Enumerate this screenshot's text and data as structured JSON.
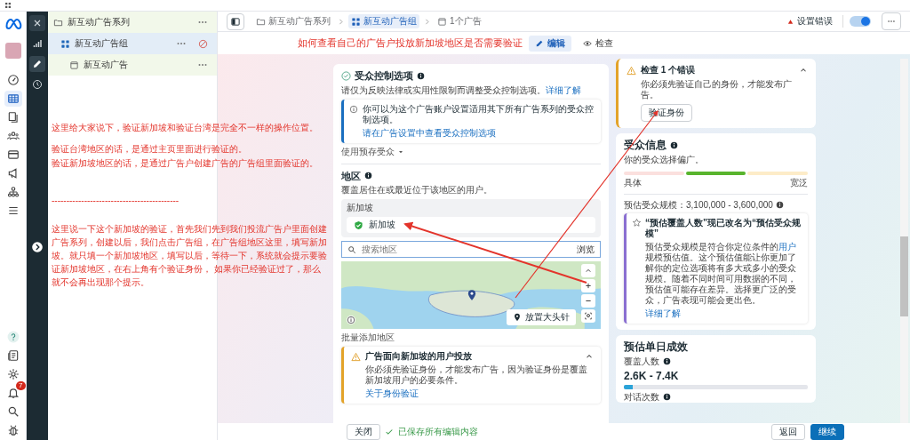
{
  "app_rail": {
    "items": [
      {
        "selected": false
      },
      {
        "selected": true
      },
      {
        "selected": false
      },
      {
        "selected": false
      },
      {
        "selected": false
      },
      {
        "selected": false
      },
      {
        "selected": false
      },
      {
        "selected": false
      }
    ],
    "notification_badge": "7"
  },
  "tool_rail": {
    "items": [
      {
        "selected": false
      },
      {
        "selected": true
      },
      {
        "selected": false
      }
    ]
  },
  "tree": [
    {
      "label": "新互动广告系列",
      "selected": false,
      "error": false,
      "children": [
        {
          "label": "新互动广告组",
          "selected": true,
          "error": true,
          "children": [
            {
              "label": "新互动广告",
              "selected": false,
              "error": false
            }
          ]
        }
      ]
    }
  ],
  "breadcrumbs": [
    {
      "label": "新互动广告系列",
      "selected": false
    },
    {
      "label": "新互动广告组",
      "selected": true
    },
    {
      "label": "1个广告",
      "selected": false
    }
  ],
  "status": {
    "label": "设置错误",
    "toggle_on": true
  },
  "mode_tabs": [
    {
      "label": "编辑",
      "selected": true
    },
    {
      "label": "检查",
      "selected": false
    }
  ],
  "audience_controls": {
    "title": "受众控制选项",
    "description": "请仅为反映法律或实用性限制而调整受众控制选项。",
    "learn_more": "详细了解",
    "info_text": "你可以为这个广告账户设置适用其下所有广告系列的受众控制选项。",
    "info_link": "请在广告设置中查看受众控制选项",
    "saved_audience": "使用预存受众"
  },
  "location": {
    "title": "地区",
    "description": "覆盖居住在或最近位于该地区的用户。",
    "group": "新加坡",
    "items": [
      {
        "label": "新加坡",
        "included": true
      }
    ],
    "search": {
      "placeholder": "搜索地区"
    },
    "browse": "浏览",
    "drop_pin": "放置大头针",
    "bulk_add": "批量添加地区"
  },
  "warning": {
    "title": "广告面向新加坡的用户投放",
    "body": "你必须先验证身份，才能发布广告，因为验证身份是覆盖新加坡用户的必要条件。",
    "link": "关于身份验证",
    "expanded": true
  },
  "error_card": {
    "title": "检查 1 个错误",
    "body": "你必须先验证自己的身份，才能发布广告。",
    "button": "验证身份",
    "expanded": true
  },
  "audience_info": {
    "title": "受众信息",
    "description": "你的受众选择偏广。",
    "segments": [
      {
        "selected": false
      },
      {
        "selected": true
      },
      {
        "selected": false
      }
    ],
    "left_label": "具体",
    "right_label": "宽泛",
    "size": "预估受众规模：3,100,000 - 3,600,000",
    "notice": {
      "title": "“预估覆盖人数”现已改名为“预估受众规模”",
      "body_before": "预估受众规模是符合你定位条件的",
      "body_link": "用户",
      "body_after": "规模预估值。这个预估值能让你更加了解你的定位选项将有多大或多小的受众规模。随着不同时间可用数据的不同，预估值可能存在差异。选择更广泛的受众，广告表现可能会更出色。",
      "link": "详细了解"
    }
  },
  "daily_results": {
    "title": "预估单日成效",
    "metrics": [
      {
        "label": "覆盖人数",
        "value": "2.6K - 7.4K",
        "level": 0.05
      },
      {
        "label": "对话次数"
      }
    ]
  },
  "footer": {
    "close": "关闭",
    "saved": "已保存所有编辑内容",
    "back": "返回",
    "continue": "继续"
  },
  "annotations": {
    "heading": "如何查看自己的广告户投放新加坡地区是否需要验证",
    "lines": [
      "这里给大家说下，验证新加坡和验证台湾是完全不一样的操作位置。",
      "验证台湾地区的话，是通过主页里面进行验证的。",
      "验证新加坡地区的话，是通过广告户创建广告的广告组里面验证的。"
    ],
    "divider": "-------------------------------------------",
    "paragraph": "这里说一下这个新加坡的验证，首先我们先到我们投流广告户里面创建广告系列，创建以后，我们点击广告组，在广告组地区这里，填写新加坡。就只填一个新加坡地区，填写以后，等待一下，系统就会提示要验证新加坡地区，在右上角有个验证身份， 如果你已经验证过了，那么就不会再出现那个提示。"
  }
}
